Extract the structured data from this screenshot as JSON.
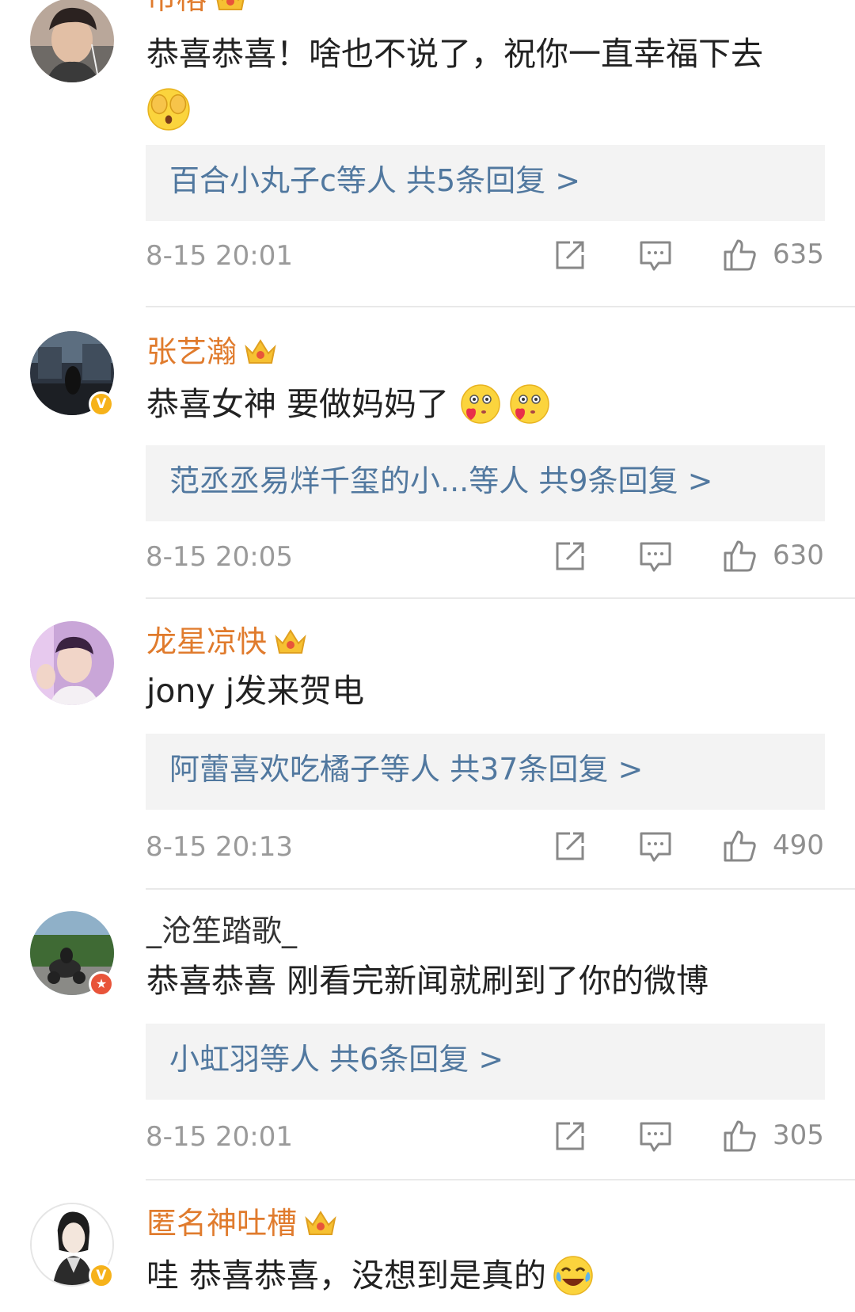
{
  "colors": {
    "vip_name": "#e07b2d",
    "reply_link": "#51789f",
    "meta_gray": "#9a9a9a",
    "reply_bg": "#f3f3f3"
  },
  "comments": [
    {
      "username": "市榕",
      "text": "恭喜恭喜！啥也不说了，祝你一直幸福下去",
      "emoji": "shy-cover-face-emoji",
      "replies_summary": "百合小丸子c等人  共5条回复 >",
      "time": "8-15 20:01",
      "likes": "635"
    },
    {
      "username": "张艺瀚",
      "badge": "V",
      "text": "恭喜女神  要做妈妈了",
      "emoji": "heart-eyes-emoji",
      "replies_summary": "范丞丞易烊千玺的小...等人  共9条回复 >",
      "time": "8-15 20:05",
      "likes": "630"
    },
    {
      "username": "龙星凉快",
      "text": "jony j发来贺电",
      "replies_summary": "阿蕾喜欢吃橘子等人  共37条回复 >",
      "time": "8-15 20:13",
      "likes": "490"
    },
    {
      "username": "_沧笙踏歌_",
      "badge": "★",
      "text": "恭喜恭喜 刚看完新闻就刷到了你的微博",
      "replies_summary": "小虹羽等人  共6条回复 >",
      "time": "8-15 20:01",
      "likes": "305"
    },
    {
      "username": "匿名神吐槽",
      "badge": "V",
      "text": "哇 恭喜恭喜，没想到是真的",
      "emoji": "laugh-cry-emoji"
    }
  ]
}
